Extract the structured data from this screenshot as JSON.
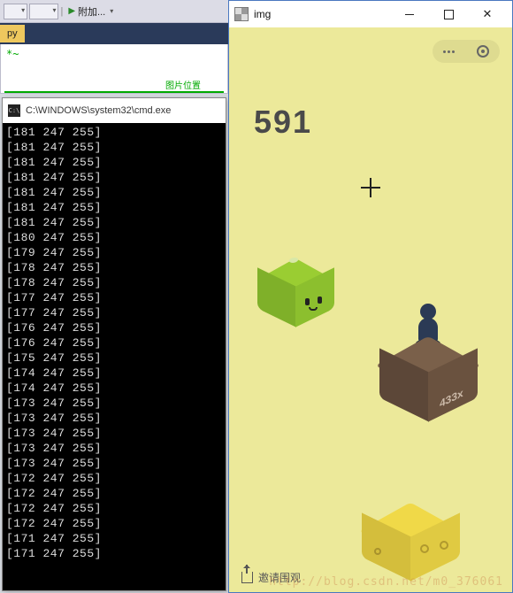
{
  "vs": {
    "attach_label": "附加..."
  },
  "pytab": {
    "label": "py",
    "star": "*~",
    "green_hint": "图片位置"
  },
  "cmd": {
    "title": "C:\\WINDOWS\\system32\\cmd.exe",
    "lines": [
      "[181 247 255]",
      "[181 247 255]",
      "[181 247 255]",
      "[181 247 255]",
      "[181 247 255]",
      "[181 247 255]",
      "[181 247 255]",
      "[180 247 255]",
      "[179 247 255]",
      "[178 247 255]",
      "[178 247 255]",
      "[177 247 255]",
      "[177 247 255]",
      "[176 247 255]",
      "[176 247 255]",
      "[175 247 255]",
      "[174 247 255]",
      "[174 247 255]",
      "[173 247 255]",
      "[173 247 255]",
      "[173 247 255]",
      "[173 247 255]",
      "[173 247 255]",
      "[172 247 255]",
      "[172 247 255]",
      "[172 247 255]",
      "[172 247 255]",
      "[171 247 255]",
      "[171 247 255]"
    ]
  },
  "imgwin": {
    "title": "img"
  },
  "game": {
    "score": "591",
    "box_label": "433x",
    "invite": "邀请围观"
  },
  "watermark": "http://blog.csdn.net/m0_376061"
}
